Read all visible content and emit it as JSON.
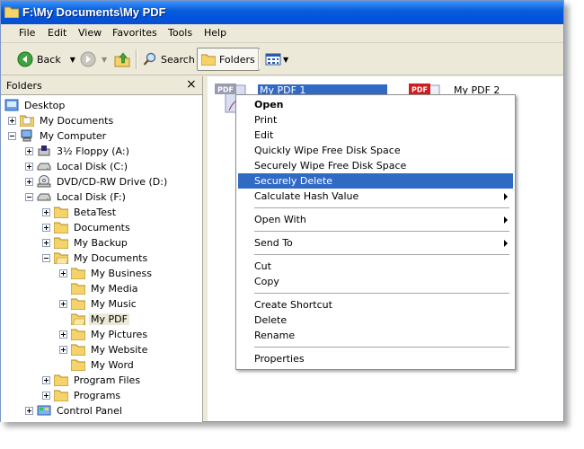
{
  "window": {
    "title": "F:\\My Documents\\My PDF"
  },
  "menu": [
    "File",
    "Edit",
    "View",
    "Favorites",
    "Tools",
    "Help"
  ],
  "toolbar": {
    "back": "Back",
    "search": "Search",
    "folders": "Folders"
  },
  "folders_pane": {
    "title": "Folders",
    "close": "×"
  },
  "tree": [
    {
      "label": "Desktop"
    },
    {
      "label": "My Documents"
    },
    {
      "label": "My Computer"
    },
    {
      "label": "3½ Floppy (A:)"
    },
    {
      "label": "Local Disk (C:)"
    },
    {
      "label": "DVD/CD-RW Drive (D:)"
    },
    {
      "label": "Local Disk (F:)"
    },
    {
      "label": "BetaTest"
    },
    {
      "label": "Documents"
    },
    {
      "label": "My Backup"
    },
    {
      "label": "My Documents"
    },
    {
      "label": "My Business"
    },
    {
      "label": "My Media"
    },
    {
      "label": "My Music"
    },
    {
      "label": "My PDF"
    },
    {
      "label": "My Pictures"
    },
    {
      "label": "My Website"
    },
    {
      "label": "My Word"
    },
    {
      "label": "Program Files"
    },
    {
      "label": "Programs"
    },
    {
      "label": "Control Panel"
    }
  ],
  "files": [
    {
      "name": "My PDF 1",
      "badge": "PDF"
    },
    {
      "name": "My PDF 2",
      "badge": "PDF"
    }
  ],
  "context_menu": [
    {
      "label": "Open"
    },
    {
      "label": "Print"
    },
    {
      "label": "Edit"
    },
    {
      "label": "Quickly Wipe Free Disk Space"
    },
    {
      "label": "Securely Wipe Free Disk Space"
    },
    {
      "label": "Securely Delete"
    },
    {
      "label": "Calculate Hash Value"
    },
    {
      "label": "Open With"
    },
    {
      "label": "Send To"
    },
    {
      "label": "Cut"
    },
    {
      "label": "Copy"
    },
    {
      "label": "Create Shortcut"
    },
    {
      "label": "Delete"
    },
    {
      "label": "Rename"
    },
    {
      "label": "Properties"
    }
  ],
  "colors": {
    "highlight": "#316ac5",
    "titlebar": "#0054e3",
    "folder": "#f5d26a",
    "pdf_badge": "#cc1f1f"
  }
}
